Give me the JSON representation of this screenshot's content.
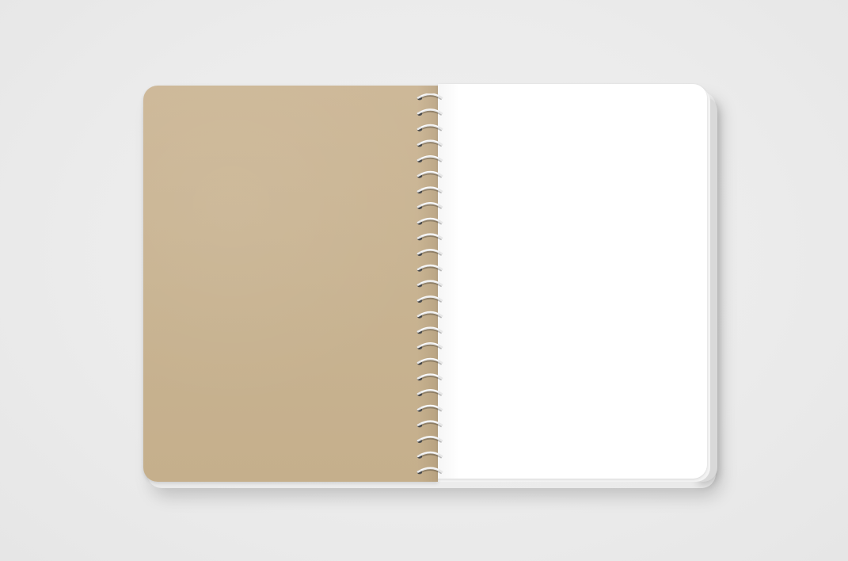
{
  "scene": {
    "description_label": "",
    "background_color": "#ececec",
    "kraft_color": "#c9b492",
    "page_color": "#ffffff",
    "coil_color": "#e8e8e8",
    "coil_loops": 25
  }
}
